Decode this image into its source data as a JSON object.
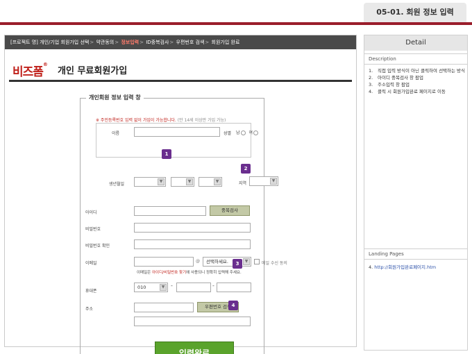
{
  "page_id": "05-01. 회원 정보 입력",
  "breadcrumb": {
    "project": "[프로젝트 명]",
    "steps": [
      "개인/기업 회원가입 선택",
      "약관동의",
      "정보입력",
      "ID중복검사",
      "우편번호 검색",
      "회원가입 완료"
    ],
    "active_index": 2,
    "separator": ">"
  },
  "brand": {
    "logo_text": "비즈폼",
    "logo_reg": "®"
  },
  "page_title": "개인 무료회원가입",
  "form": {
    "legend": "개인회원 정보 입력 창",
    "notice": "※ 주민등록번호 입력 없이 가입이 가능합니다.",
    "notice_sub": "(만 14세 이상만 가입 가능)",
    "name_label": "이름",
    "gender_label": "성별",
    "gender_male": "남",
    "gender_female": "여",
    "birth_label": "생년월일",
    "region_label": "지역",
    "id_label": "아이디",
    "dup_check_button": "중복검사",
    "password_label": "비밀번호",
    "password_confirm_label": "비밀번호 확인",
    "email_label": "이메일",
    "email_at": "@",
    "email_domain_select": "선택하세요.",
    "email_receive_label": "메일 수신 동의",
    "email_hint_pre": "이메일은",
    "email_hint_red": "아이디/비밀번호 찾기",
    "email_hint_post": "에 사용되니 정확히 입력해 주세요.",
    "phone_label": "휴대폰",
    "phone_prefix": "010",
    "phone_dash": "-",
    "address_label": "주소",
    "zip_search_button": "우편번호 검색",
    "submit_button": "입력완료"
  },
  "markers": [
    "1",
    "2",
    "3",
    "4"
  ],
  "detail_panel": {
    "header": "Detail",
    "description_title": "Description",
    "description_items": [
      {
        "num": "1.",
        "text": "직접 입력 방식이 아닌 클릭하여 선택하는 방식"
      },
      {
        "num": "2.",
        "text": "아이디 중복검사 창 팝업"
      },
      {
        "num": "3.",
        "text": "주소입력 창 팝업"
      },
      {
        "num": "4.",
        "text": "클릭 시 회원가입완료 페이지로 이동"
      }
    ],
    "landing_title": "Landing Pages",
    "landing_item_num": "4.",
    "landing_item_url": "http://회원가입완료페이지.htm"
  },
  "colors": {
    "brand_red": "#c0211b",
    "accent_bar": "#9a1d2b",
    "marker_purple": "#6a2e8e",
    "submit_green": "#5aa32c"
  }
}
